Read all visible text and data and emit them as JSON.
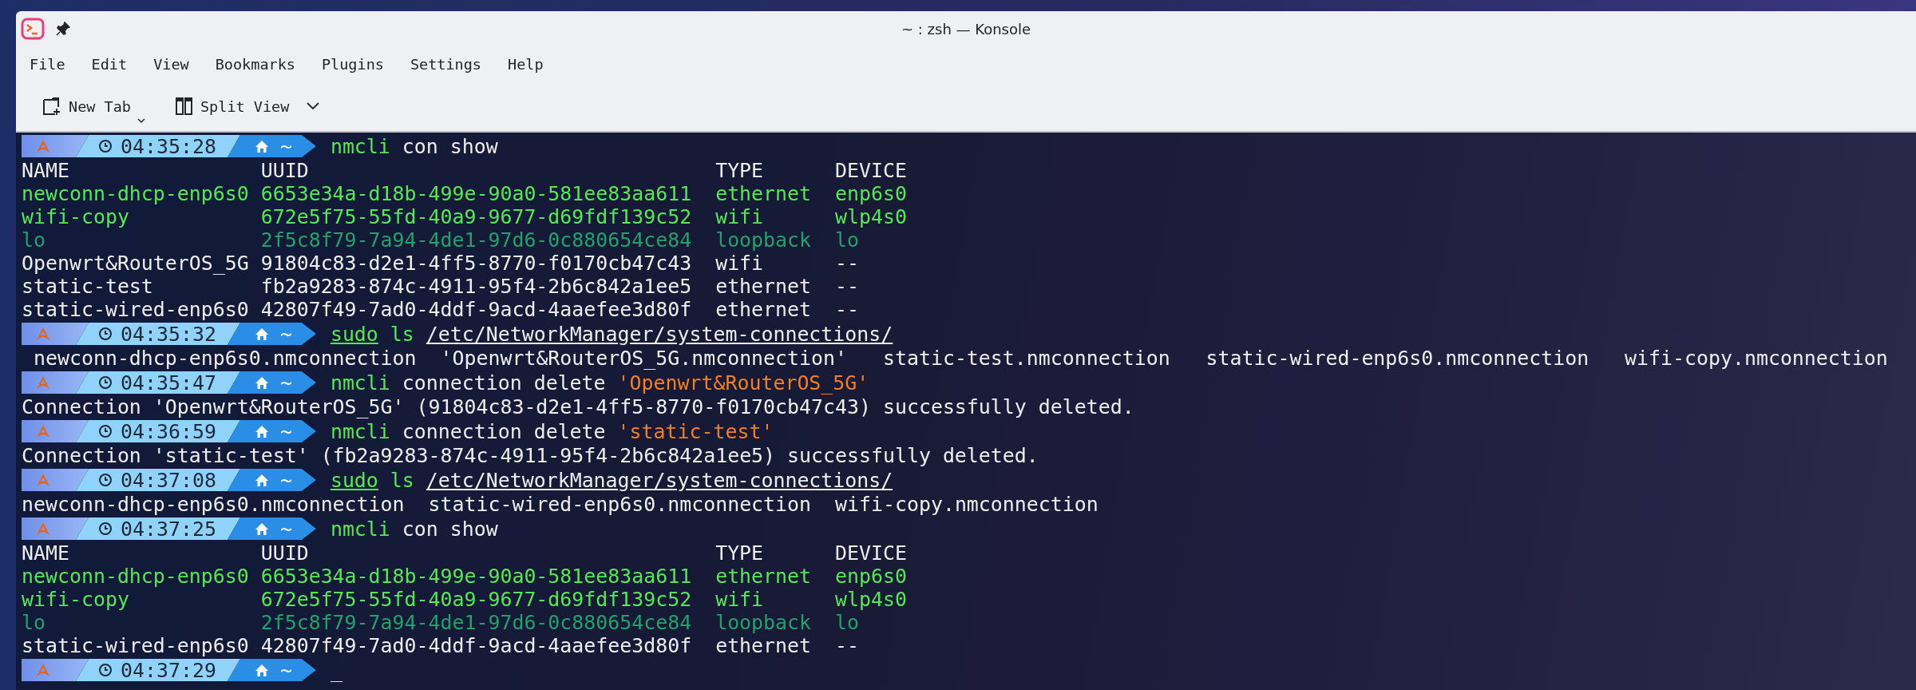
{
  "window": {
    "title": "~ : zsh — Konsole"
  },
  "menu": [
    "File",
    "Edit",
    "View",
    "Bookmarks",
    "Plugins",
    "Settings",
    "Help"
  ],
  "toolbar": [
    {
      "label": "New Tab",
      "kind": "new-tab"
    },
    {
      "label": "Split View",
      "kind": "split-view"
    }
  ],
  "terminal": {
    "blocks": [
      {
        "kind": "prompt",
        "time": "04:35:28",
        "dir": "~",
        "command": [
          {
            "text": "nmcli",
            "kind": "command"
          },
          {
            "text": "con show",
            "kind": "argument"
          }
        ]
      },
      {
        "kind": "table",
        "columns": [
          "NAME",
          "UUID",
          "TYPE",
          "DEVICE"
        ],
        "rows": [
          {
            "kind": "connected",
            "cells": [
              "newconn-dhcp-enp6s0",
              "6653e34a-d18b-499e-90a0-581ee83aa611",
              "ethernet",
              "enp6s0"
            ]
          },
          {
            "kind": "connected",
            "cells": [
              "wifi-copy",
              "672e5f75-55fd-40a9-9677-d69fdf139c52",
              "wifi",
              "wlp4s0"
            ]
          },
          {
            "kind": "loopback",
            "cells": [
              "lo",
              "2f5c8f79-7a94-4de1-97d6-0c880654ce84",
              "loopback",
              "lo"
            ]
          },
          {
            "kind": "inactive",
            "cells": [
              "Openwrt&RouterOS_5G",
              "91804c83-d2e1-4ff5-8770-f0170cb47c43",
              "wifi",
              "--"
            ]
          },
          {
            "kind": "inactive",
            "cells": [
              "static-test",
              "fb2a9283-874c-4911-95f4-2b6c842a1ee5",
              "ethernet",
              "--"
            ]
          },
          {
            "kind": "inactive",
            "cells": [
              "static-wired-enp6s0",
              "42807f49-7ad0-4ddf-9acd-4aaefee3d80f",
              "ethernet",
              "--"
            ]
          }
        ]
      },
      {
        "kind": "prompt",
        "time": "04:35:32",
        "dir": "~",
        "command": [
          {
            "text": "sudo",
            "kind": "sudo"
          },
          {
            "text": "ls",
            "kind": "command"
          },
          {
            "text": "/etc/NetworkManager/system-connections/",
            "kind": "path"
          }
        ]
      },
      {
        "kind": "files-quoted",
        "items": [
          "newconn-dhcp-enp6s0.nmconnection",
          "'Openwrt&RouterOS_5G.nmconnection'",
          "static-test.nmconnection",
          "static-wired-enp6s0.nmconnection",
          "wifi-copy.nmconnection"
        ]
      },
      {
        "kind": "prompt",
        "time": "04:35:47",
        "dir": "~",
        "command": [
          {
            "text": "nmcli",
            "kind": "command"
          },
          {
            "text": "connection delete",
            "kind": "argument"
          },
          {
            "text": "'Openwrt&RouterOS_5G'",
            "kind": "quoted"
          }
        ]
      },
      {
        "kind": "text",
        "text": "Connection 'Openwrt&RouterOS_5G' (91804c83-d2e1-4ff5-8770-f0170cb47c43) successfully deleted."
      },
      {
        "kind": "prompt",
        "time": "04:36:59",
        "dir": "~",
        "command": [
          {
            "text": "nmcli",
            "kind": "command"
          },
          {
            "text": "connection delete",
            "kind": "argument"
          },
          {
            "text": "'static-test'",
            "kind": "quoted"
          }
        ]
      },
      {
        "kind": "text",
        "text": "Connection 'static-test' (fb2a9283-874c-4911-95f4-2b6c842a1ee5) successfully deleted."
      },
      {
        "kind": "prompt",
        "time": "04:37:08",
        "dir": "~",
        "command": [
          {
            "text": "sudo",
            "kind": "sudo"
          },
          {
            "text": "ls",
            "kind": "command"
          },
          {
            "text": "/etc/NetworkManager/system-connections/",
            "kind": "path"
          }
        ]
      },
      {
        "kind": "files",
        "items": [
          "newconn-dhcp-enp6s0.nmconnection",
          "static-wired-enp6s0.nmconnection",
          "wifi-copy.nmconnection"
        ]
      },
      {
        "kind": "prompt",
        "time": "04:37:25",
        "dir": "~",
        "command": [
          {
            "text": "nmcli",
            "kind": "command"
          },
          {
            "text": "con show",
            "kind": "argument"
          }
        ]
      },
      {
        "kind": "table",
        "columns": [
          "NAME",
          "UUID",
          "TYPE",
          "DEVICE"
        ],
        "rows": [
          {
            "kind": "connected",
            "cells": [
              "newconn-dhcp-enp6s0",
              "6653e34a-d18b-499e-90a0-581ee83aa611",
              "ethernet",
              "enp6s0"
            ]
          },
          {
            "kind": "connected",
            "cells": [
              "wifi-copy",
              "672e5f75-55fd-40a9-9677-d69fdf139c52",
              "wifi",
              "wlp4s0"
            ]
          },
          {
            "kind": "loopback",
            "cells": [
              "lo",
              "2f5c8f79-7a94-4de1-97d6-0c880654ce84",
              "loopback",
              "lo"
            ]
          },
          {
            "kind": "inactive",
            "cells": [
              "static-wired-enp6s0",
              "42807f49-7ad0-4ddf-9acd-4aaefee3d80f",
              "ethernet",
              "--"
            ]
          }
        ]
      },
      {
        "kind": "prompt",
        "time": "04:37:29",
        "dir": "~",
        "cursor": "_"
      }
    ]
  }
}
